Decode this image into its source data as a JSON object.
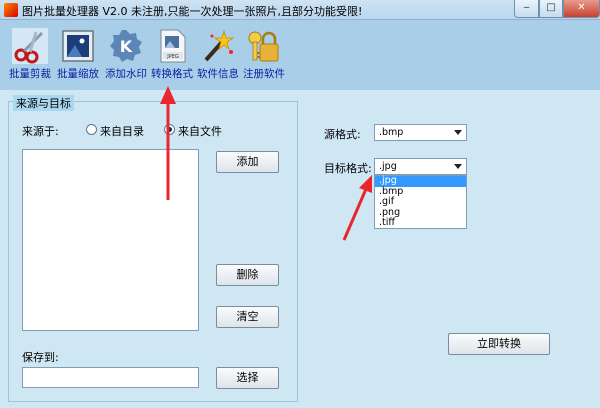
{
  "window": {
    "title": "图片批量处理器 V2.0  未注册,只能一次处理一张照片,且部分功能受限!",
    "min_glyph": "‒",
    "max_glyph": "□",
    "close_glyph": "✕"
  },
  "toolbar": [
    {
      "label": "批量剪裁",
      "icon": "scissors-icon"
    },
    {
      "label": "批量缩放",
      "icon": "picture-frame-icon"
    },
    {
      "label": "添加水印",
      "icon": "k-logo-icon"
    },
    {
      "label": "转换格式",
      "icon": "jpeg-file-icon"
    },
    {
      "label": "软件信息",
      "icon": "magic-wand-icon"
    },
    {
      "label": "注册软件",
      "icon": "key-lock-icon"
    }
  ],
  "source_panel": {
    "legend": "来源与目标",
    "source_label": "来源于:",
    "radio_directory": "来自目录",
    "radio_file": "来自文件",
    "selected": "file",
    "add_button": "添加",
    "delete_button": "删除",
    "clear_button": "清空",
    "save_label": "保存到:",
    "save_value": "",
    "browse_button": "选择"
  },
  "format_panel": {
    "source_format_label": "源格式:",
    "source_format_value": ".bmp",
    "target_format_label": "目标格式:",
    "target_format_value": ".jpg",
    "target_options": [
      ".jpg",
      ".bmp",
      ".gif",
      ".png",
      ".tiff"
    ],
    "highlighted_option": ".jpg",
    "convert_button": "立即转换"
  },
  "colors": {
    "annotation_arrow": "#e8262d",
    "toolbar_label": "#0a1ea0",
    "selection": "#3399ff"
  }
}
